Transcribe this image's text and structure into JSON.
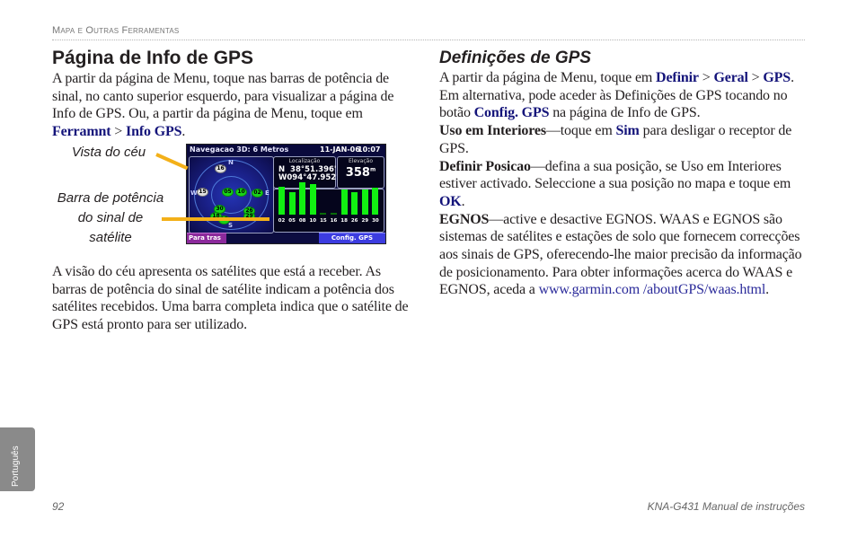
{
  "running_header": "Mapa e Outras Ferramentas",
  "left": {
    "title": "Página de Info de GPS",
    "intro": {
      "text": "A partir da página de Menu, toque nas barras de potência de sinal, no canto superior esquerdo, para visualizar a página de Info de GPS. Ou, a partir da página de Menu, toque em ",
      "kw1": "Ferramnt",
      "sep": " > ",
      "kw2": "Info GPS",
      "end": "."
    },
    "callouts": {
      "sky_view": "Vista do céu",
      "signal_bars_1": "Barra de potência",
      "signal_bars_2": "do sinal de",
      "signal_bars_3": "satélite"
    },
    "body2": "A visão do céu apresenta os satélites que está a receber. As barras de potência do sinal de satélite indicam a potência dos satélites recebidos. Uma barra completa indica que o satélite de GPS está pronto para ser utilizado."
  },
  "device": {
    "title": "Navegacao 3D: 6 Metros",
    "date": "11-JAN-06",
    "time": "10:07",
    "compass": {
      "n": "N",
      "e": "E",
      "s": "S",
      "w": "W"
    },
    "location_label": "Localização",
    "lat": "N  38°51.396'",
    "lon": "W094°47.952'",
    "elevation_label": "Elevação",
    "elevation_value": "358",
    "elevation_unit": "m",
    "satellites": [
      {
        "id": "16",
        "active": false
      },
      {
        "id": "15",
        "active": false
      },
      {
        "id": "05",
        "active": true
      },
      {
        "id": "10",
        "active": true
      },
      {
        "id": "02",
        "active": true
      },
      {
        "id": "30",
        "active": true
      },
      {
        "id": "18",
        "active": true
      },
      {
        "id": "05b",
        "label": "05",
        "active": true
      },
      {
        "id": "26",
        "active": true
      },
      {
        "id": "29",
        "active": true
      }
    ],
    "signal_bars": [
      {
        "sat": "02",
        "strength": 0.82
      },
      {
        "sat": "05",
        "strength": 0.66
      },
      {
        "sat": "08",
        "strength": 0.95
      },
      {
        "sat": "10",
        "strength": 0.9
      },
      {
        "sat": "15",
        "strength": 0.06
      },
      {
        "sat": "16",
        "strength": 0.06
      },
      {
        "sat": "18",
        "strength": 0.74
      },
      {
        "sat": "26",
        "strength": 0.66
      },
      {
        "sat": "29",
        "strength": 0.74
      },
      {
        "sat": "30",
        "strength": 0.78
      }
    ],
    "back_button": "Para tras",
    "config_button": "Config. GPS"
  },
  "right": {
    "title": "Definições de GPS",
    "p1": {
      "a": "A partir da página de Menu, toque em ",
      "k1": "Definir",
      "s1": " > ",
      "k2": "Geral",
      "s2": " > ",
      "k3": "GPS",
      "b": ". Em alternativa, pode aceder às Definições de GPS tocando no botão ",
      "k4": "Config. GPS",
      "c": " na página de Info de GPS."
    },
    "p2": {
      "term": "Uso em Interiores",
      "a": "—toque em ",
      "k": "Sim",
      "b": " para desligar o receptor de GPS."
    },
    "p3": {
      "term": "Definir Posicao",
      "a": "—defina a sua posição, se Uso em Interiores estiver activado. Seleccione a sua posição no mapa e toque em ",
      "k": "OK",
      "b": "."
    },
    "p4": {
      "term": "EGNOS",
      "a": "—active e desactive EGNOS. WAAS e EGNOS são sistemas de satélites e estações de solo que fornecem correcções aos sinais de GPS, oferecendo-lhe maior precisão da informação de posicionamento. Para obter informações acerca do WAAS e EGNOS, aceda a ",
      "link": "www.garmin.com /aboutGPS/waas.html",
      "b": "."
    }
  },
  "language_tab": "Português",
  "page_number": "92",
  "manual_title": "KNA-G431 Manual de instruções",
  "colors": {
    "keyword": "#14147a",
    "leader": "#f3b019",
    "signal_green": "#12f012"
  }
}
